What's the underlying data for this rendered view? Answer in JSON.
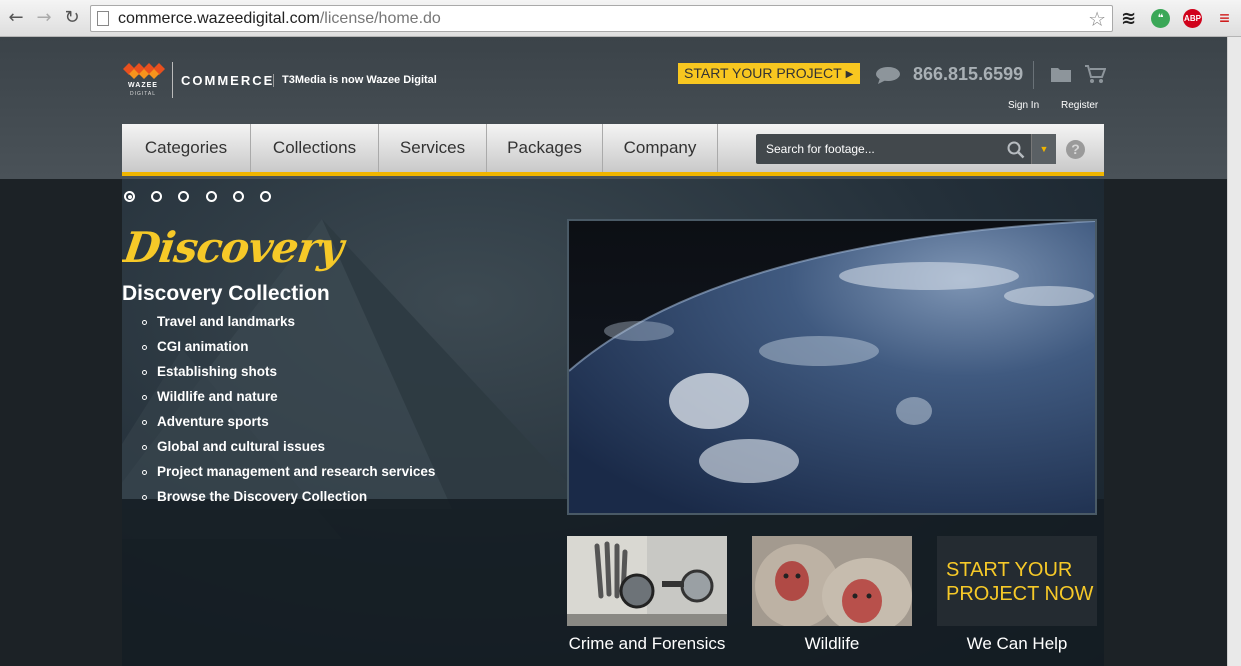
{
  "browser": {
    "url_domain": "commerce.wazeedigital.com",
    "url_path": "/license/home.do",
    "abp_badge": "ABP"
  },
  "header": {
    "logo_text": "WAZEE",
    "logo_subtext": "DIGITAL",
    "commerce_label": "COMMERCE",
    "tagline": "T3Media is now Wazee Digital",
    "start_project": "START YOUR PROJECT",
    "phone": "866.815.6599",
    "sign_in": "Sign In",
    "register": "Register"
  },
  "nav": {
    "items": [
      "Categories",
      "Collections",
      "Services",
      "Packages",
      "Company"
    ],
    "search_placeholder": "Search for footage...",
    "help": "?"
  },
  "hero": {
    "slide_count": 6,
    "active_slide": 1,
    "logo_word": "Discovery",
    "collection_title": "Discovery Collection",
    "features": [
      "Travel and landmarks",
      "CGI animation",
      "Establishing shots",
      "Wildlife and nature",
      "Adventure sports",
      "Global and cultural issues",
      "Project management and research services",
      "Browse the Discovery Collection"
    ]
  },
  "thumbnails": [
    {
      "label": "Crime and Forensics"
    },
    {
      "label": "Wildlife"
    },
    {
      "label": "We Can Help",
      "overlay": "START YOUR PROJECT NOW"
    }
  ],
  "colors": {
    "accent_yellow": "#f8c720",
    "nav_underline": "#f0b500",
    "header_bg": "#3b4349"
  }
}
